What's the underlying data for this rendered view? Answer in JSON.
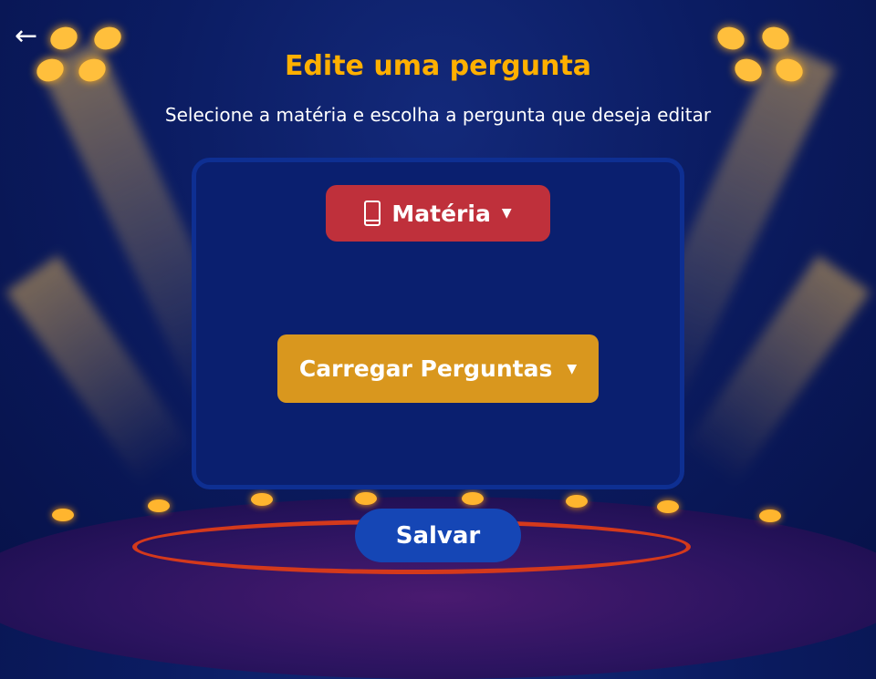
{
  "header": {
    "back_icon": "arrow-left-icon",
    "title": "Edite uma pergunta",
    "subtitle": "Selecione a matéria e escolha a pergunta que deseja editar"
  },
  "form": {
    "subject_dropdown": {
      "label": "Matéria",
      "icon": "book-icon",
      "color": "#bf303b"
    },
    "questions_dropdown": {
      "label": "Carregar Perguntas",
      "color": "#d9971e"
    },
    "save_button": {
      "label": "Salvar",
      "color": "#1546b5"
    }
  },
  "colors": {
    "title": "#ffb000",
    "background": "#0b1c62"
  }
}
